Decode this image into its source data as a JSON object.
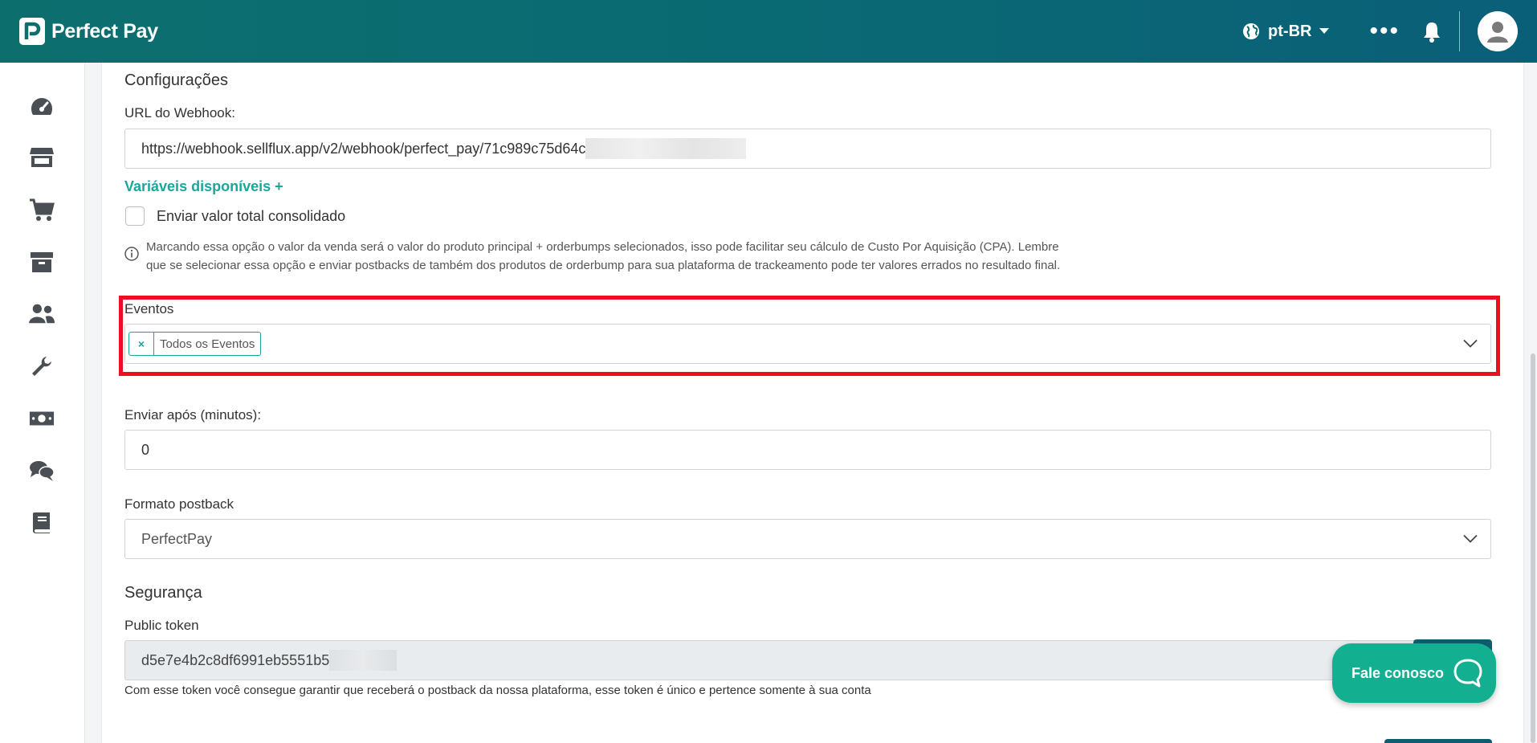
{
  "header": {
    "brand": "Perfect Pay",
    "language": "pt-BR",
    "more_label": "•••"
  },
  "sidebar": {
    "items": [
      {
        "name": "dashboard",
        "icon": "gauge-icon"
      },
      {
        "name": "store",
        "icon": "store-icon"
      },
      {
        "name": "cart",
        "icon": "cart-icon"
      },
      {
        "name": "products",
        "icon": "box-icon"
      },
      {
        "name": "users",
        "icon": "users-icon"
      },
      {
        "name": "tools",
        "icon": "wrench-icon"
      },
      {
        "name": "finance",
        "icon": "money-icon"
      },
      {
        "name": "chat",
        "icon": "chat-icon"
      },
      {
        "name": "docs",
        "icon": "book-icon"
      }
    ]
  },
  "config": {
    "title": "Configurações",
    "webhook_label": "URL do Webhook:",
    "webhook_value": "https://webhook.sellflux.app/v2/webhook/perfect_pay/71c989c75d64c",
    "variables_link": "Variáveis disponíveis +",
    "checkbox_label": "Enviar valor total consolidado",
    "info_line1": "Marcando essa opção o valor da venda será o valor do produto principal + orderbumps selecionados, isso pode facilitar seu cálculo de Custo Por Aquisição (CPA). Lembre",
    "info_line2": "que se selecionar essa opção e enviar postbacks de também dos produtos de orderbump para sua plataforma de trackeamento pode ter valores errados no resultado final."
  },
  "events": {
    "label": "Eventos",
    "tag_remove": "×",
    "tag_label": "Todos os Eventos"
  },
  "delay": {
    "label": "Enviar após (minutos):",
    "value": "0"
  },
  "format": {
    "label": "Formato postback",
    "value": "PerfectPay"
  },
  "security": {
    "title": "Segurança",
    "token_label": "Public token",
    "token_value": "d5e7e4b2c8df6991eb5551b5",
    "token_help": "Com esse token você consegue garantir que receberá o postback da nossa plataforma, esse token é único e pertence somente à sua conta"
  },
  "support": {
    "label": "Fale conosco"
  },
  "colors": {
    "brand": "#0c6f6e",
    "accent": "#1aa79a",
    "highlight": "#ee0d23",
    "chat_button": "#12b091"
  }
}
